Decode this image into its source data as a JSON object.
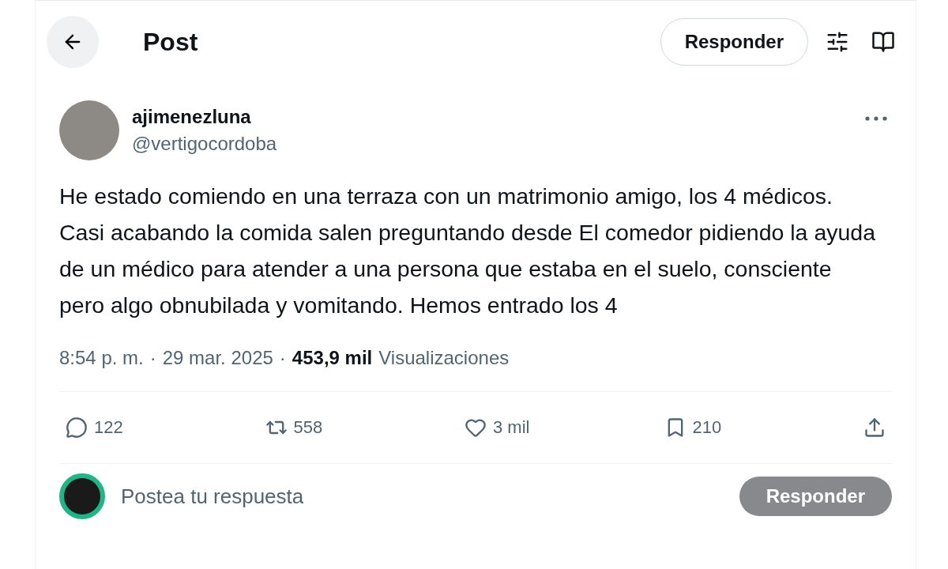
{
  "header": {
    "title": "Post",
    "reply_button": "Responder"
  },
  "post": {
    "display_name": "ajimenezluna",
    "handle": "@vertigocordoba",
    "text": "He estado comiendo en una terraza con un matrimonio amigo, los 4 médicos. Casi acabando la comida salen preguntando desde El comedor pidiendo la ayuda de un médico para atender a una persona que estaba en el suelo, consciente pero algo obnubilada y vomitando. Hemos entrado los 4",
    "time": "8:54 p. m.",
    "separator": "·",
    "date": "29 mar. 2025",
    "views_count": "453,9 mil",
    "views_label": "Visualizaciones"
  },
  "actions": [
    {
      "kind": "reply",
      "count": "122"
    },
    {
      "kind": "repost",
      "count": "558"
    },
    {
      "kind": "like",
      "count": "3 mil"
    },
    {
      "kind": "bookmark",
      "count": "210"
    },
    {
      "kind": "share"
    }
  ],
  "composer": {
    "placeholder": "Postea tu respuesta",
    "button": "Responder",
    "disabled": true
  }
}
